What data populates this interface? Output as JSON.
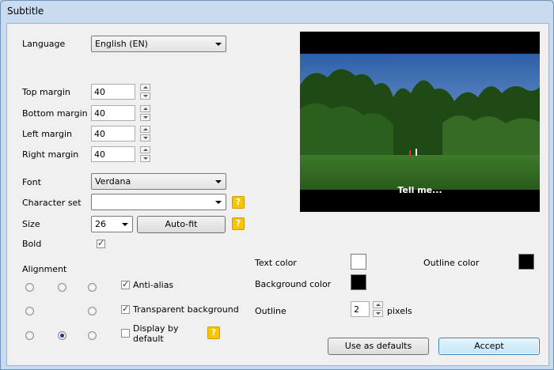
{
  "window": {
    "title": "Subtitle"
  },
  "form": {
    "language": {
      "label": "Language",
      "value": "English (EN)"
    },
    "top_margin": {
      "label": "Top margin",
      "value": "40"
    },
    "bottom_margin": {
      "label": "Bottom margin",
      "value": "40"
    },
    "left_margin": {
      "label": "Left margin",
      "value": "40"
    },
    "right_margin": {
      "label": "Right margin",
      "value": "40"
    },
    "font": {
      "label": "Font",
      "value": "Verdana"
    },
    "charset": {
      "label": "Character set",
      "value": ""
    },
    "size": {
      "label": "Size",
      "value": "26",
      "autofit_label": "Auto-fit"
    },
    "bold": {
      "label": "Bold",
      "checked": true
    },
    "alignment": {
      "label": "Alignment",
      "selected": "bottom-center"
    },
    "antialias": {
      "label": "Anti-alias",
      "checked": true
    },
    "transparent_bg": {
      "label": "Transparent background",
      "checked": true
    },
    "display_default": {
      "label_line1": "Display by",
      "label_line2": "default",
      "checked": false
    },
    "text_color": {
      "label": "Text color",
      "color": "#ffffff"
    },
    "outline_color": {
      "label": "Outline color",
      "color": "#000000"
    },
    "background_color": {
      "label": "Background color",
      "color": "#000000"
    },
    "outline": {
      "label": "Outline",
      "value": "2",
      "unit": "pixels"
    }
  },
  "preview": {
    "caption": "Tell me..."
  },
  "buttons": {
    "use_defaults": "Use as defaults",
    "accept": "Accept"
  },
  "icons": {
    "help": "?"
  }
}
